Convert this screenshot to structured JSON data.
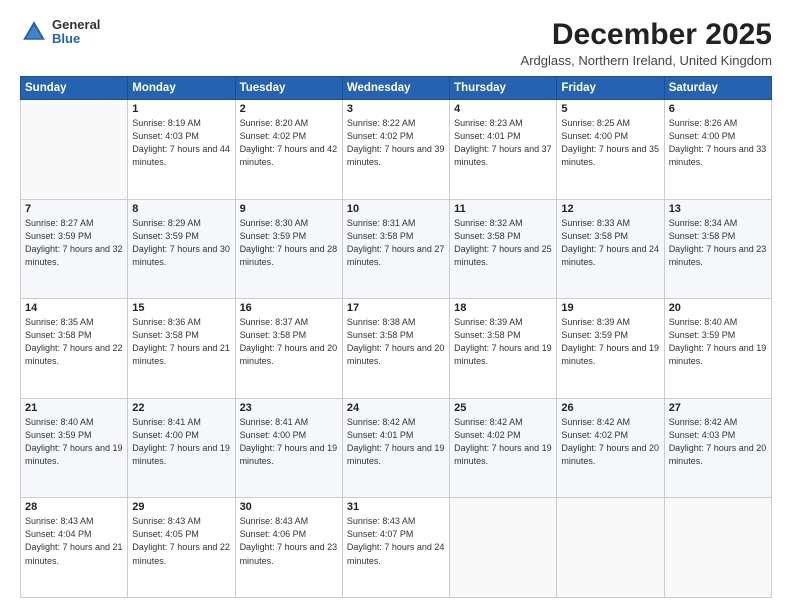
{
  "logo": {
    "general": "General",
    "blue": "Blue"
  },
  "header": {
    "title": "December 2025",
    "location": "Ardglass, Northern Ireland, United Kingdom"
  },
  "weekdays": [
    "Sunday",
    "Monday",
    "Tuesday",
    "Wednesday",
    "Thursday",
    "Friday",
    "Saturday"
  ],
  "weeks": [
    [
      {
        "day": "",
        "sunrise": "",
        "sunset": "",
        "daylight": ""
      },
      {
        "day": "1",
        "sunrise": "Sunrise: 8:19 AM",
        "sunset": "Sunset: 4:03 PM",
        "daylight": "Daylight: 7 hours and 44 minutes."
      },
      {
        "day": "2",
        "sunrise": "Sunrise: 8:20 AM",
        "sunset": "Sunset: 4:02 PM",
        "daylight": "Daylight: 7 hours and 42 minutes."
      },
      {
        "day": "3",
        "sunrise": "Sunrise: 8:22 AM",
        "sunset": "Sunset: 4:02 PM",
        "daylight": "Daylight: 7 hours and 39 minutes."
      },
      {
        "day": "4",
        "sunrise": "Sunrise: 8:23 AM",
        "sunset": "Sunset: 4:01 PM",
        "daylight": "Daylight: 7 hours and 37 minutes."
      },
      {
        "day": "5",
        "sunrise": "Sunrise: 8:25 AM",
        "sunset": "Sunset: 4:00 PM",
        "daylight": "Daylight: 7 hours and 35 minutes."
      },
      {
        "day": "6",
        "sunrise": "Sunrise: 8:26 AM",
        "sunset": "Sunset: 4:00 PM",
        "daylight": "Daylight: 7 hours and 33 minutes."
      }
    ],
    [
      {
        "day": "7",
        "sunrise": "Sunrise: 8:27 AM",
        "sunset": "Sunset: 3:59 PM",
        "daylight": "Daylight: 7 hours and 32 minutes."
      },
      {
        "day": "8",
        "sunrise": "Sunrise: 8:29 AM",
        "sunset": "Sunset: 3:59 PM",
        "daylight": "Daylight: 7 hours and 30 minutes."
      },
      {
        "day": "9",
        "sunrise": "Sunrise: 8:30 AM",
        "sunset": "Sunset: 3:59 PM",
        "daylight": "Daylight: 7 hours and 28 minutes."
      },
      {
        "day": "10",
        "sunrise": "Sunrise: 8:31 AM",
        "sunset": "Sunset: 3:58 PM",
        "daylight": "Daylight: 7 hours and 27 minutes."
      },
      {
        "day": "11",
        "sunrise": "Sunrise: 8:32 AM",
        "sunset": "Sunset: 3:58 PM",
        "daylight": "Daylight: 7 hours and 25 minutes."
      },
      {
        "day": "12",
        "sunrise": "Sunrise: 8:33 AM",
        "sunset": "Sunset: 3:58 PM",
        "daylight": "Daylight: 7 hours and 24 minutes."
      },
      {
        "day": "13",
        "sunrise": "Sunrise: 8:34 AM",
        "sunset": "Sunset: 3:58 PM",
        "daylight": "Daylight: 7 hours and 23 minutes."
      }
    ],
    [
      {
        "day": "14",
        "sunrise": "Sunrise: 8:35 AM",
        "sunset": "Sunset: 3:58 PM",
        "daylight": "Daylight: 7 hours and 22 minutes."
      },
      {
        "day": "15",
        "sunrise": "Sunrise: 8:36 AM",
        "sunset": "Sunset: 3:58 PM",
        "daylight": "Daylight: 7 hours and 21 minutes."
      },
      {
        "day": "16",
        "sunrise": "Sunrise: 8:37 AM",
        "sunset": "Sunset: 3:58 PM",
        "daylight": "Daylight: 7 hours and 20 minutes."
      },
      {
        "day": "17",
        "sunrise": "Sunrise: 8:38 AM",
        "sunset": "Sunset: 3:58 PM",
        "daylight": "Daylight: 7 hours and 20 minutes."
      },
      {
        "day": "18",
        "sunrise": "Sunrise: 8:39 AM",
        "sunset": "Sunset: 3:58 PM",
        "daylight": "Daylight: 7 hours and 19 minutes."
      },
      {
        "day": "19",
        "sunrise": "Sunrise: 8:39 AM",
        "sunset": "Sunset: 3:59 PM",
        "daylight": "Daylight: 7 hours and 19 minutes."
      },
      {
        "day": "20",
        "sunrise": "Sunrise: 8:40 AM",
        "sunset": "Sunset: 3:59 PM",
        "daylight": "Daylight: 7 hours and 19 minutes."
      }
    ],
    [
      {
        "day": "21",
        "sunrise": "Sunrise: 8:40 AM",
        "sunset": "Sunset: 3:59 PM",
        "daylight": "Daylight: 7 hours and 19 minutes."
      },
      {
        "day": "22",
        "sunrise": "Sunrise: 8:41 AM",
        "sunset": "Sunset: 4:00 PM",
        "daylight": "Daylight: 7 hours and 19 minutes."
      },
      {
        "day": "23",
        "sunrise": "Sunrise: 8:41 AM",
        "sunset": "Sunset: 4:00 PM",
        "daylight": "Daylight: 7 hours and 19 minutes."
      },
      {
        "day": "24",
        "sunrise": "Sunrise: 8:42 AM",
        "sunset": "Sunset: 4:01 PM",
        "daylight": "Daylight: 7 hours and 19 minutes."
      },
      {
        "day": "25",
        "sunrise": "Sunrise: 8:42 AM",
        "sunset": "Sunset: 4:02 PM",
        "daylight": "Daylight: 7 hours and 19 minutes."
      },
      {
        "day": "26",
        "sunrise": "Sunrise: 8:42 AM",
        "sunset": "Sunset: 4:02 PM",
        "daylight": "Daylight: 7 hours and 20 minutes."
      },
      {
        "day": "27",
        "sunrise": "Sunrise: 8:42 AM",
        "sunset": "Sunset: 4:03 PM",
        "daylight": "Daylight: 7 hours and 20 minutes."
      }
    ],
    [
      {
        "day": "28",
        "sunrise": "Sunrise: 8:43 AM",
        "sunset": "Sunset: 4:04 PM",
        "daylight": "Daylight: 7 hours and 21 minutes."
      },
      {
        "day": "29",
        "sunrise": "Sunrise: 8:43 AM",
        "sunset": "Sunset: 4:05 PM",
        "daylight": "Daylight: 7 hours and 22 minutes."
      },
      {
        "day": "30",
        "sunrise": "Sunrise: 8:43 AM",
        "sunset": "Sunset: 4:06 PM",
        "daylight": "Daylight: 7 hours and 23 minutes."
      },
      {
        "day": "31",
        "sunrise": "Sunrise: 8:43 AM",
        "sunset": "Sunset: 4:07 PM",
        "daylight": "Daylight: 7 hours and 24 minutes."
      },
      {
        "day": "",
        "sunrise": "",
        "sunset": "",
        "daylight": ""
      },
      {
        "day": "",
        "sunrise": "",
        "sunset": "",
        "daylight": ""
      },
      {
        "day": "",
        "sunrise": "",
        "sunset": "",
        "daylight": ""
      }
    ]
  ]
}
